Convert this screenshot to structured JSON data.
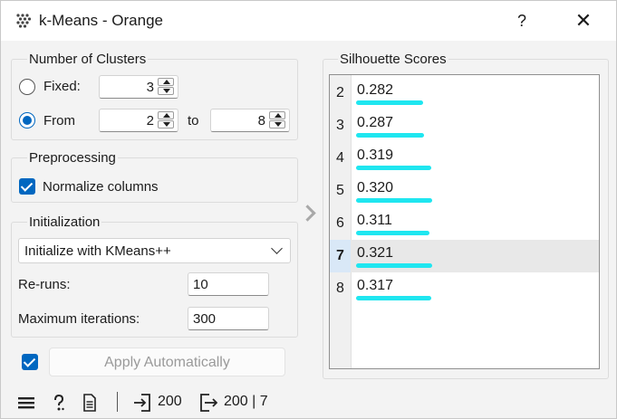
{
  "window": {
    "title": "k-Means - Orange",
    "help_label": "?",
    "close_label": "✕"
  },
  "clusters": {
    "title": "Number of Clusters",
    "fixed_label": "Fixed:",
    "fixed_value": "3",
    "from_label": "From",
    "from_value": "2",
    "to_label": "to",
    "to_value": "8",
    "selected_mode": "From"
  },
  "preprocessing": {
    "title": "Preprocessing",
    "normalize_label": "Normalize columns",
    "normalize_checked": true
  },
  "initialization": {
    "title": "Initialization",
    "method": "Initialize with KMeans++",
    "reruns_label": "Re-runs:",
    "reruns_value": "10",
    "max_iter_label": "Maximum iterations:",
    "max_iter_value": "300"
  },
  "apply": {
    "label": "Apply Automatically",
    "checked": true
  },
  "silhouette": {
    "title": "Silhouette Scores",
    "rows": [
      {
        "k": "2",
        "score": "0.282",
        "bar_fraction": 0.879
      },
      {
        "k": "3",
        "score": "0.287",
        "bar_fraction": 0.894
      },
      {
        "k": "4",
        "score": "0.319",
        "bar_fraction": 0.994
      },
      {
        "k": "5",
        "score": "0.320",
        "bar_fraction": 0.997
      },
      {
        "k": "6",
        "score": "0.311",
        "bar_fraction": 0.969
      },
      {
        "k": "7",
        "score": "0.321",
        "bar_fraction": 1.0
      },
      {
        "k": "8",
        "score": "0.317",
        "bar_fraction": 0.988
      }
    ],
    "selected_k": "7",
    "bar_color": "#1fe6f0"
  },
  "status": {
    "input_count": "200",
    "output_count": "200 | 7"
  },
  "colors": {
    "accent": "#0067c0",
    "background": "#f3f3f3"
  }
}
